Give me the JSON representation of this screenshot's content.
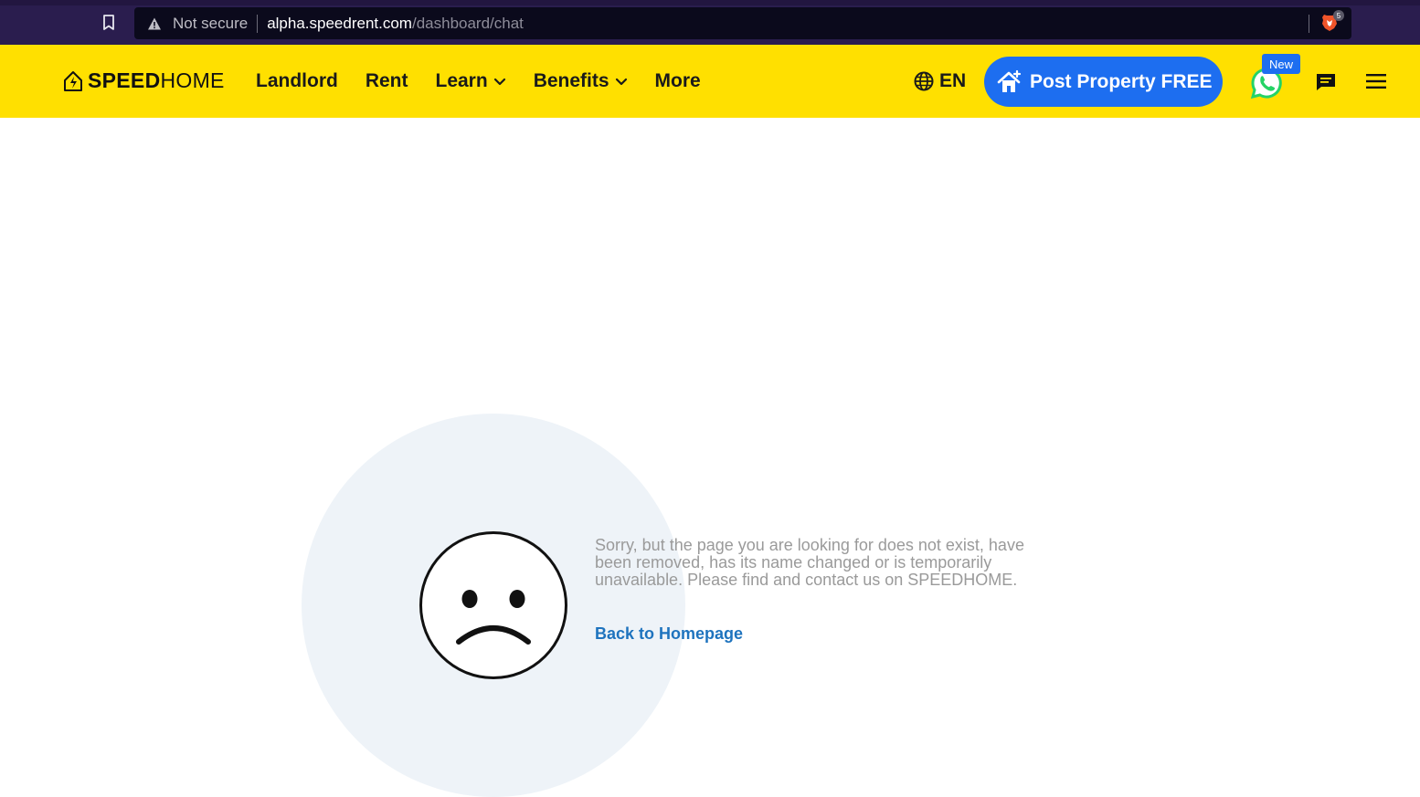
{
  "browser": {
    "not_secure_label": "Not secure",
    "url_host": "alpha.speedrent.com",
    "url_path": "/dashboard/chat",
    "shield_badge_count": "5"
  },
  "header": {
    "logo_bold": "SPEED",
    "logo_light": "HOME",
    "nav": [
      {
        "label": "Landlord"
      },
      {
        "label": "Rent"
      },
      {
        "label": "Learn"
      },
      {
        "label": "Benefits"
      },
      {
        "label": "More"
      }
    ],
    "language": "EN",
    "post_button_label": "Post Property FREE",
    "new_badge": "New",
    "colors": {
      "header_bg": "#ffe000",
      "primary_blue": "#1d6ef0",
      "whatsapp_green": "#25d366"
    }
  },
  "main": {
    "error_message": "Sorry, but the page you are looking for does not exist, have been removed, has its name changed or is temporarily unavailable. Please find and contact us on SPEEDHOME.",
    "back_link_label": "Back to Homepage"
  }
}
